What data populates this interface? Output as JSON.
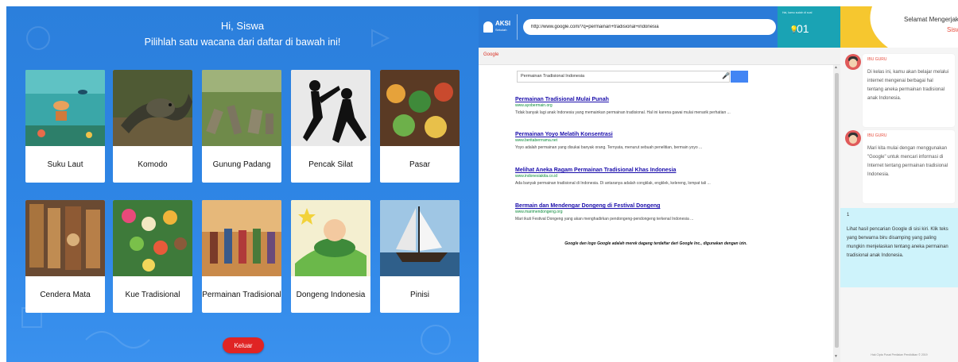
{
  "left_panel": {
    "greeting": "Hi, Siswa",
    "instruction": "Pilihlah satu wacana dari daftar di bawah ini!",
    "cards": [
      {
        "label": "Suku Laut"
      },
      {
        "label": "Komodo"
      },
      {
        "label": "Gunung Padang"
      },
      {
        "label": "Pencak Silat"
      },
      {
        "label": "Pasar"
      },
      {
        "label": "Cendera Mata"
      },
      {
        "label": "Kue Tradisional"
      },
      {
        "label": "Permainan Tradisional"
      },
      {
        "label": "Dongeng Indonesia"
      },
      {
        "label": "Pinisi"
      }
    ],
    "logout_label": "Keluar"
  },
  "browser": {
    "logo_main": "AKSI",
    "logo_sub": "Sekolah",
    "url": "http://www.google.com/?q=permainan+tradisional+indonesia",
    "counter_caption": "Hai, kamu sudah di soal",
    "counter_value": "01",
    "google_label": "Google",
    "search_query": "Permainan Tradisional Indonesia",
    "results": [
      {
        "title": "Permainan Tradisional Mulai Punah",
        "url": "www.ayobermain.org",
        "snippet": "Tidak banyak lagi anak Indonesia yang memainkan permainan tradisional. Hal ini karena gawai mulai menarik perhatian ..."
      },
      {
        "title": "Permainan Yoyo Melatih Konsentrasi",
        "url": "www.beritaberrrama.net",
        "snippet": "Yoyo adalah permainan yang disukai banyak orang. Ternyata, menurut sebuah penelitian, bermain yoyo ..."
      },
      {
        "title": "Melihat Aneka Ragam Permainan Tradisional Khas Indonesia",
        "url": "www.indonesiakita.co.id",
        "snippet": "Ada banyak permainan tradisional di Indonesia. Di antaranya adalah congklak, engklek, kelereng, lompat tali ..."
      },
      {
        "title": "Bermain dan Mendengar Dongeng di Festival Dongeng",
        "url": "www.marimendongeng.org",
        "snippet": "Mari ikuti Festival Dongeng yang akan menghadirkan pendongeng-pendongeng terkenal Indonesia ..."
      }
    ],
    "trademark_note": "Google dan logo Google adalah merek dagang terdaftar dari Google Inc., digunakan dengan izin."
  },
  "right_panel": {
    "header_line1": "Selamat Mengerjakan",
    "header_line2": "Siswa",
    "messages": [
      {
        "sender": "IBU GURU",
        "text": "Di kelas ini, kamu akan belajar melalui internet mengenai berbagai hal tentang aneka permainan tradisional anak Indonesia."
      },
      {
        "sender": "IBU GURU",
        "text": "Mari kita mulai dengan menggunakan \"Google\" untuk mencari informasi di Internet tentang permainan tradisional Indonesia."
      }
    ],
    "task_number": "1",
    "task_text": "Lihat hasil pencarian Google di sisi kiri. Klik teks yang berwarna biru disamping yang paling mungkin menjelaskan tentang aneka permainan tradisional anak Indonesia.",
    "footer": "Hak Cipta Pusat Penilaian Pendidikan © 2019"
  },
  "colors": {
    "left_bg": "#2f86e6",
    "topbar": "#2a7bd8",
    "counter": "#1aa3b4",
    "logout": "#e02424",
    "task_bg": "#cef3fb",
    "link": "#1a0dab",
    "green_url": "#0a8a3a",
    "accent_red": "#e74c3c"
  },
  "icons": [
    "lightbulb-icon",
    "microphone-icon",
    "scroll-up-icon",
    "scroll-down-icon",
    "teacher-avatar-icon"
  ]
}
